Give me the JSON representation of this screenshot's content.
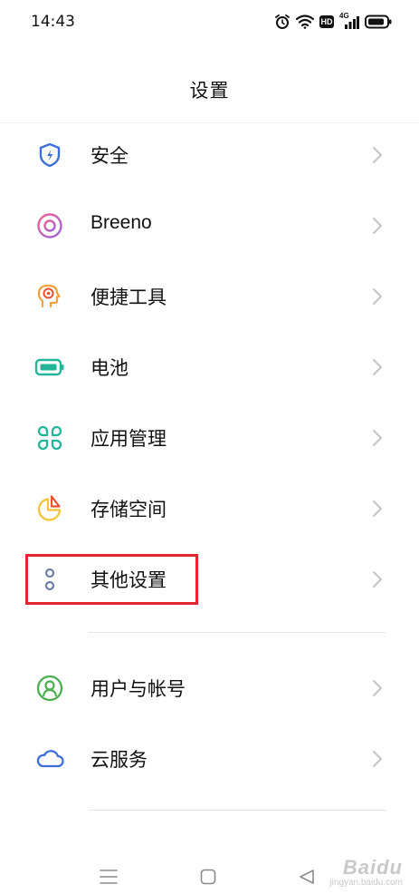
{
  "status_bar": {
    "time": "14:43",
    "icons": [
      "alarm-icon",
      "wifi-icon",
      "hd-icon",
      "4g-signal-icon",
      "battery-icon"
    ],
    "hd_label": "HD",
    "network_label": "4G"
  },
  "header": {
    "title": "设置"
  },
  "settings": {
    "items": [
      {
        "label": "安全",
        "icon": "shield-icon",
        "color": "#3e6fd8"
      },
      {
        "label": "Breeno",
        "icon": "breeno-icon",
        "color": "#d45fc3"
      },
      {
        "label": "便捷工具",
        "icon": "quick-tools-icon",
        "color": "#f2a03a"
      },
      {
        "label": "电池",
        "icon": "battery-icon",
        "color": "#22b59a"
      },
      {
        "label": "应用管理",
        "icon": "app-management-icon",
        "color": "#22b59a"
      },
      {
        "label": "存储空间",
        "icon": "storage-icon",
        "color": "#f2a03a"
      },
      {
        "label": "其他设置",
        "icon": "more-settings-icon",
        "color": "#6e7fa8"
      },
      {
        "label": "用户与帐号",
        "icon": "user-account-icon",
        "color": "#4caf50"
      },
      {
        "label": "云服务",
        "icon": "cloud-icon",
        "color": "#3e6fd8"
      }
    ]
  },
  "nav_bar": {
    "buttons": [
      "menu-icon",
      "home-icon",
      "back-icon"
    ]
  },
  "watermark": {
    "main": "Baidu",
    "sub": "jingyan.baidu.com"
  }
}
